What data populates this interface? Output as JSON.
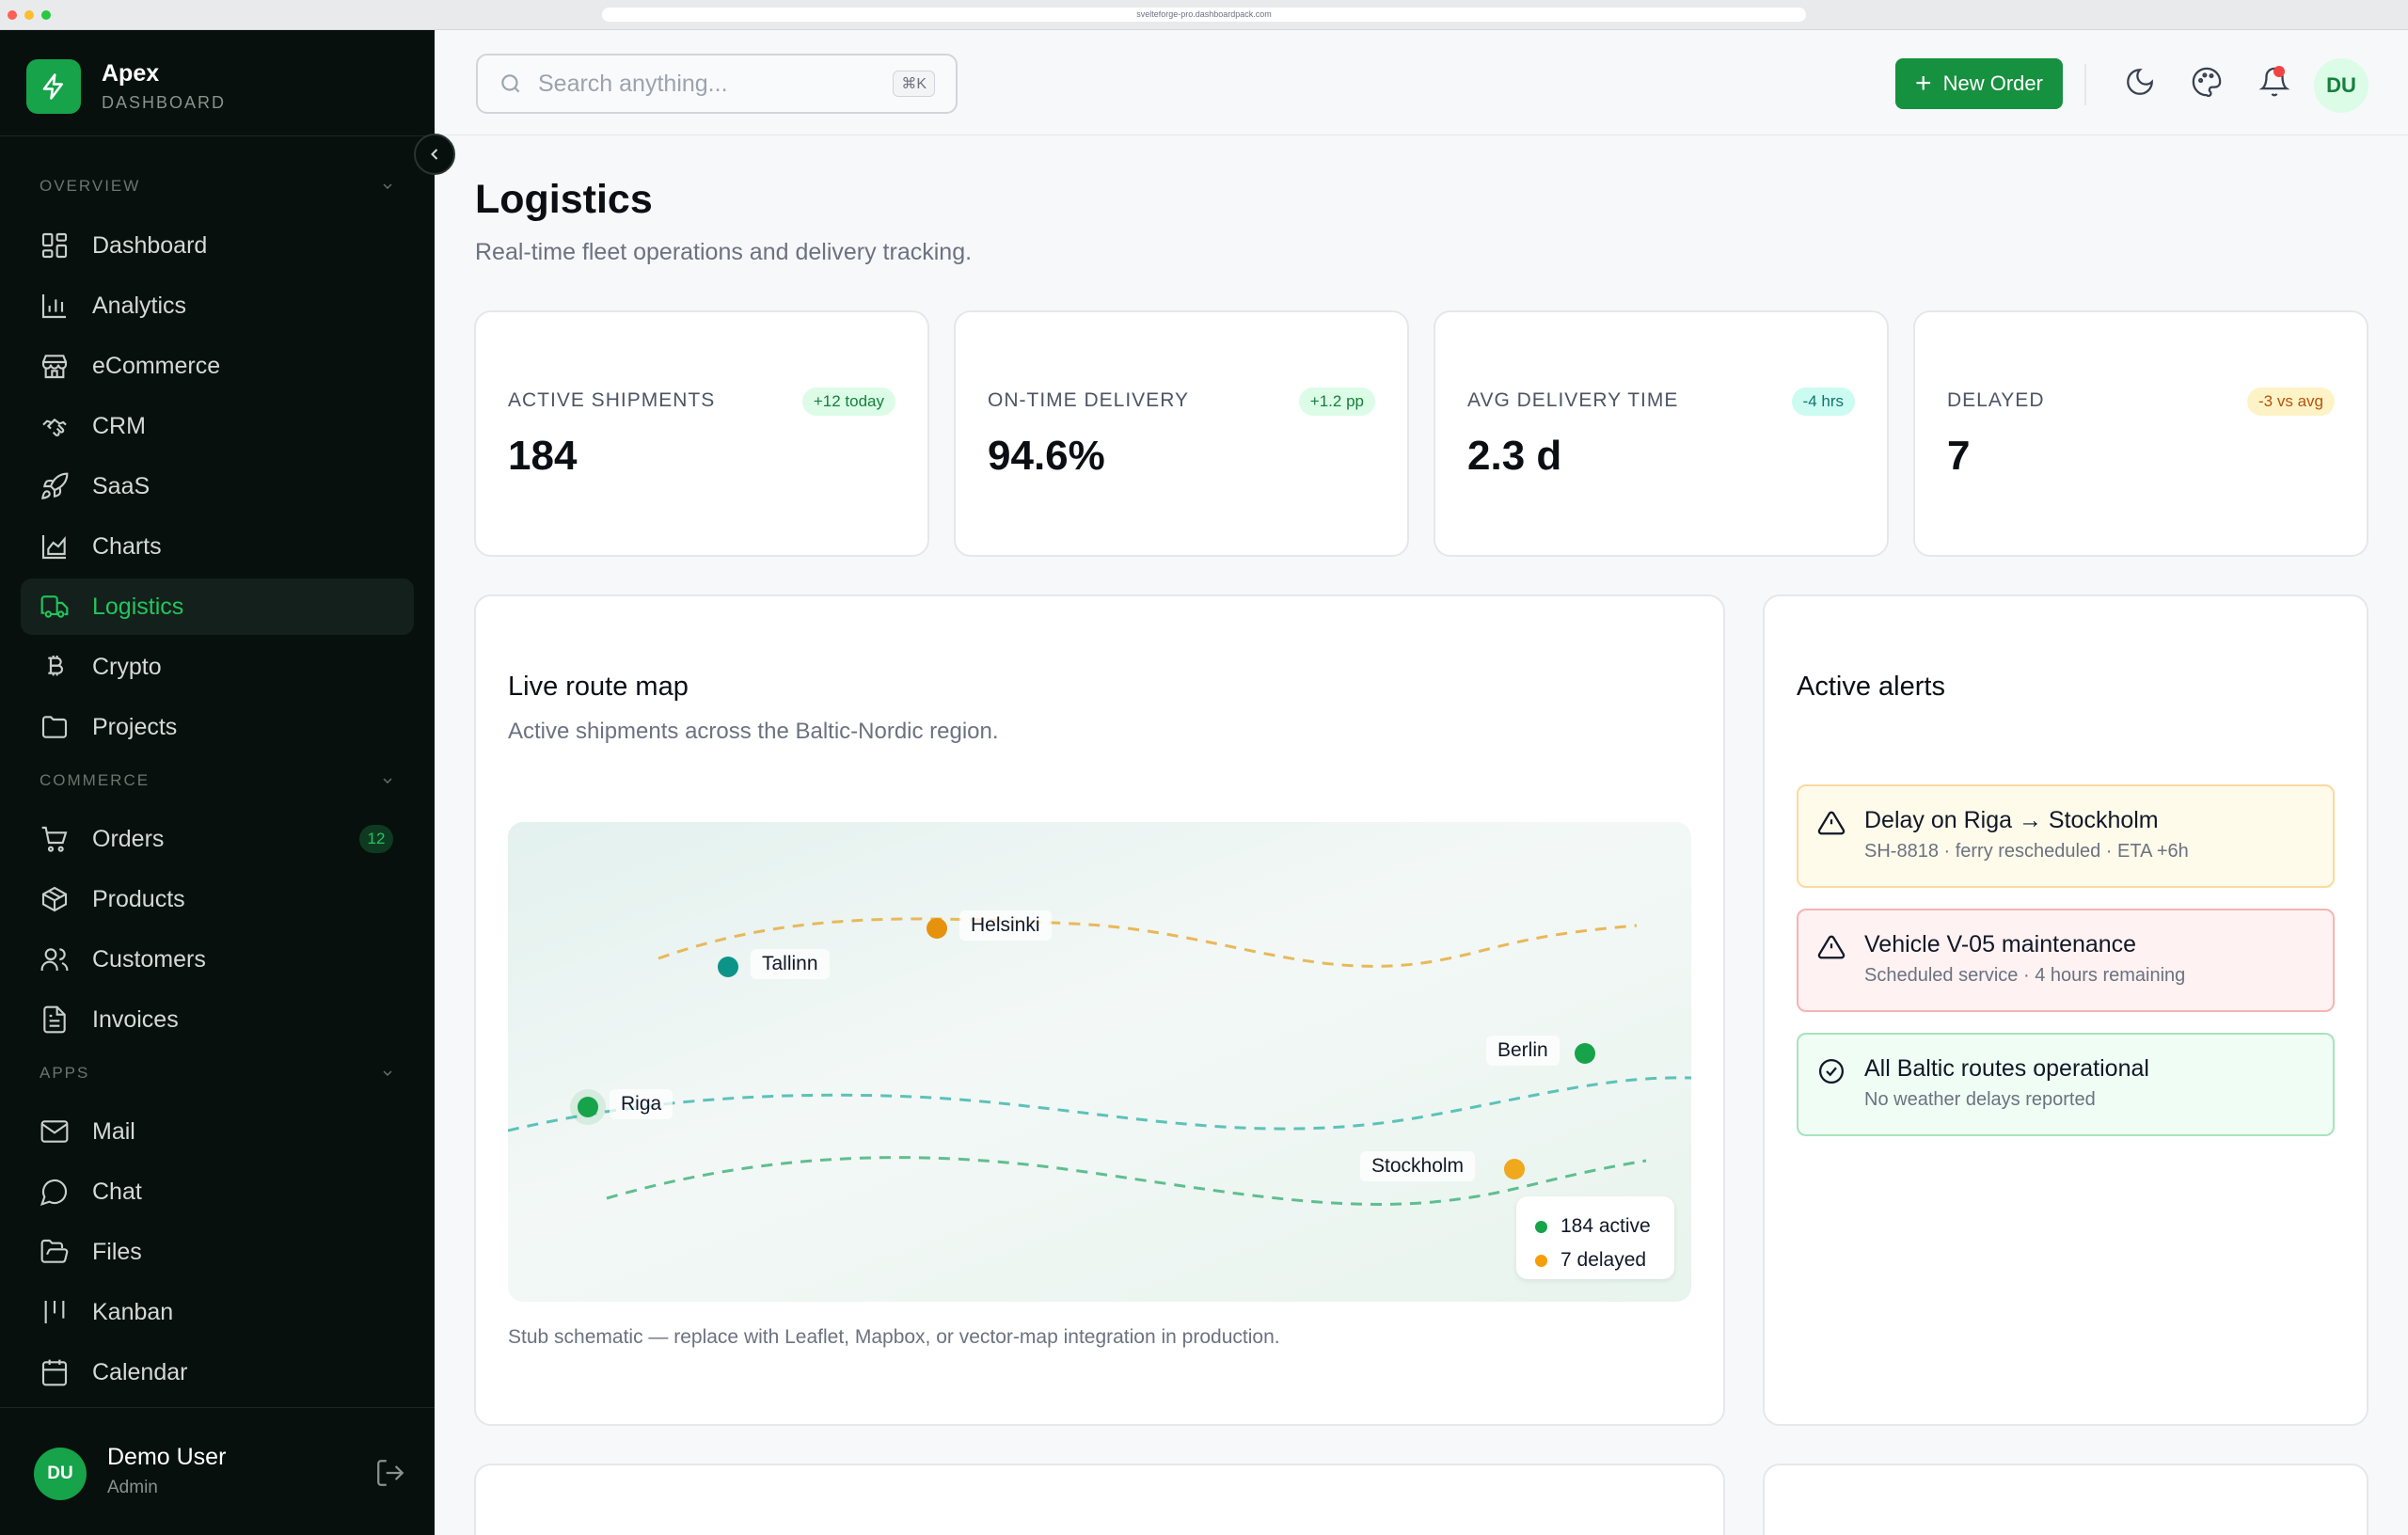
{
  "browser": {
    "url": "svelteforge-pro.dashboardpack.com"
  },
  "brand": {
    "name": "Apex",
    "subtitle": "DASHBOARD"
  },
  "sidebar": {
    "overview_label": "OVERVIEW",
    "commerce_label": "COMMERCE",
    "apps_label": "APPS",
    "overview": [
      {
        "label": "Dashboard",
        "icon": "grid-icon"
      },
      {
        "label": "Analytics",
        "icon": "bar-chart-icon"
      },
      {
        "label": "eCommerce",
        "icon": "store-icon"
      },
      {
        "label": "CRM",
        "icon": "handshake-icon"
      },
      {
        "label": "SaaS",
        "icon": "rocket-icon"
      },
      {
        "label": "Charts",
        "icon": "area-chart-icon"
      },
      {
        "label": "Logistics",
        "icon": "truck-icon",
        "active": true
      },
      {
        "label": "Crypto",
        "icon": "bitcoin-icon"
      },
      {
        "label": "Projects",
        "icon": "folder-icon"
      }
    ],
    "commerce": [
      {
        "label": "Orders",
        "icon": "cart-icon",
        "badge": "12"
      },
      {
        "label": "Products",
        "icon": "box-icon"
      },
      {
        "label": "Customers",
        "icon": "users-icon"
      },
      {
        "label": "Invoices",
        "icon": "file-icon"
      }
    ],
    "apps": [
      {
        "label": "Mail",
        "icon": "mail-icon"
      },
      {
        "label": "Chat",
        "icon": "chat-icon"
      },
      {
        "label": "Files",
        "icon": "folder-open-icon"
      },
      {
        "label": "Kanban",
        "icon": "kanban-icon"
      },
      {
        "label": "Calendar",
        "icon": "calendar-icon"
      }
    ]
  },
  "user": {
    "initials": "DU",
    "name": "Demo User",
    "role": "Admin"
  },
  "topbar": {
    "search_placeholder": "Search anything...",
    "shortcut": "⌘K",
    "new_order": "New Order",
    "avatar": "DU"
  },
  "page": {
    "title": "Logistics",
    "subtitle": "Real-time fleet operations and delivery tracking."
  },
  "kpis": [
    {
      "label": "ACTIVE SHIPMENTS",
      "value": "184",
      "badge": "+12 today",
      "badge_color": "#15803d",
      "badge_bg": "#dcfce7"
    },
    {
      "label": "ON-TIME DELIVERY",
      "value": "94.6%",
      "badge": "+1.2 pp",
      "badge_color": "#15803d",
      "badge_bg": "#dcfce7"
    },
    {
      "label": "AVG DELIVERY TIME",
      "value": "2.3 d",
      "badge": "-4 hrs",
      "badge_color": "#0f766e",
      "badge_bg": "#ccfbf1"
    },
    {
      "label": "DELAYED",
      "value": "7",
      "badge": "-3 vs avg",
      "badge_color": "#b45309",
      "badge_bg": "#fef3c7"
    }
  ],
  "map_card": {
    "title": "Live route map",
    "subtitle": "Active shipments across the Baltic-Nordic region.",
    "cities": {
      "helsinki": "Helsinki",
      "tallinn": "Tallinn",
      "riga": "Riga",
      "berlin": "Berlin",
      "stockholm": "Stockholm"
    },
    "legend_active": "184 active",
    "legend_delayed": "7 delayed",
    "note": "Stub schematic — replace with Leaflet, Mapbox, or vector-map integration in production."
  },
  "alerts_card": {
    "title": "Active alerts",
    "alerts": [
      {
        "title": "Delay on Riga → Stockholm",
        "sub": "SH-8818 · ferry rescheduled · ETA +6h",
        "type": "warning"
      },
      {
        "title": "Vehicle V-05 maintenance",
        "sub": "Scheduled service · 4 hours remaining",
        "type": "danger"
      },
      {
        "title": "All Baltic routes operational",
        "sub": "No weather delays reported",
        "type": "success"
      }
    ]
  },
  "colors": {
    "accent": "#16a34a",
    "sidebar_bg": "#07100c",
    "teal": "#0d9488",
    "amber": "#f59e0b"
  }
}
